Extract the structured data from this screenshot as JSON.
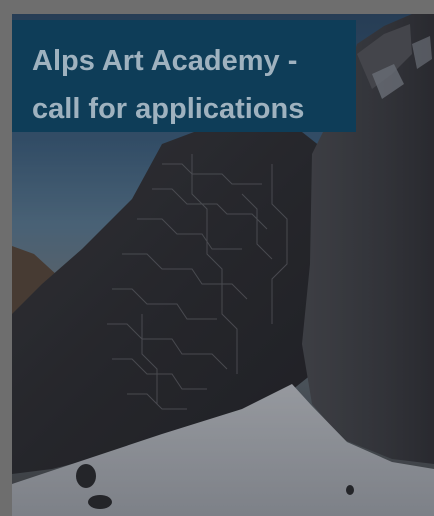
{
  "card": {
    "title": "Alps Art Academy - call for applications",
    "image_subject": "rock-face-with-circuit-engravings-above-snow"
  },
  "colors": {
    "page_background": "#6e6e6e",
    "title_background": "#0e3d58",
    "title_text": "#9fb2bf"
  }
}
